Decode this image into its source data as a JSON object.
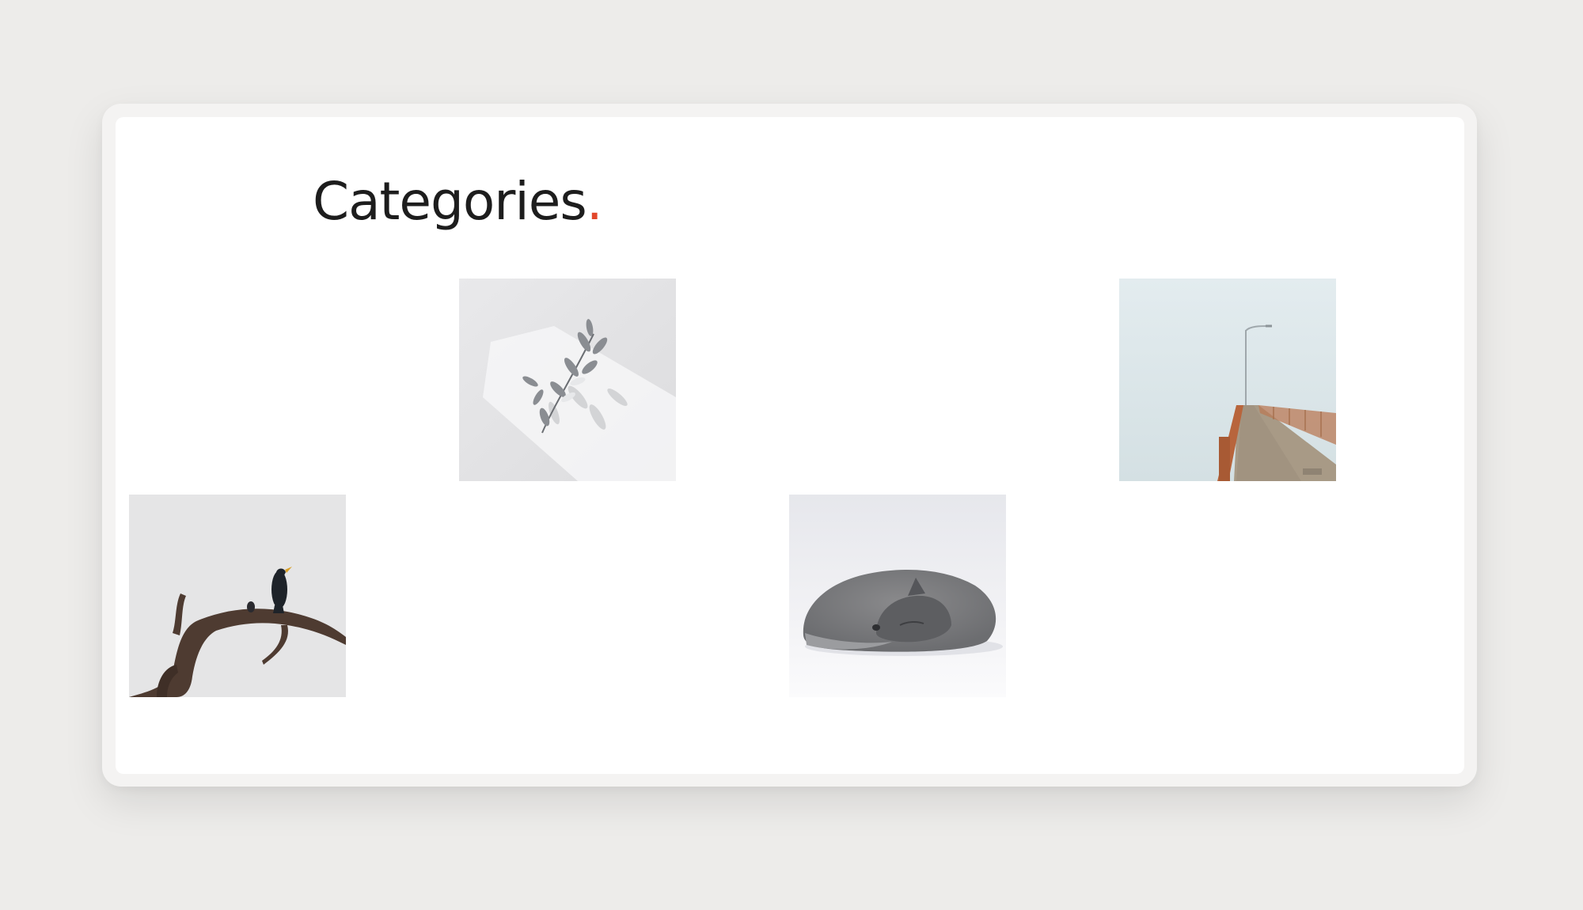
{
  "page": {
    "title": "Categories",
    "title_punctuation": ".",
    "accent_color": "#e2462a"
  },
  "categories": [
    {
      "image": "leaves-shadow-image"
    },
    {
      "image": "foggy-bridge-image"
    },
    {
      "image": "bird-on-branch-image"
    },
    {
      "image": "sleeping-arctic-fox-image"
    }
  ]
}
